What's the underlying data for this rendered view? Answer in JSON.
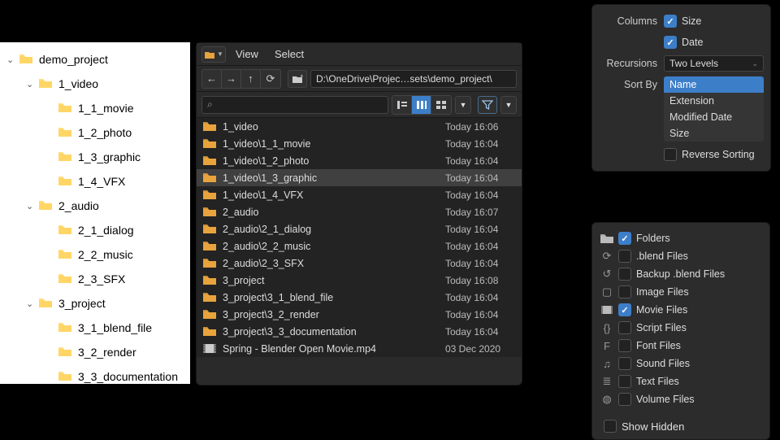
{
  "tree": {
    "root": "demo_project",
    "nodes": [
      {
        "depth": 0,
        "expand": true,
        "name": "demo_project"
      },
      {
        "depth": 1,
        "expand": true,
        "name": "1_video"
      },
      {
        "depth": 2,
        "expand": null,
        "name": "1_1_movie"
      },
      {
        "depth": 2,
        "expand": null,
        "name": "1_2_photo"
      },
      {
        "depth": 2,
        "expand": null,
        "name": "1_3_graphic"
      },
      {
        "depth": 2,
        "expand": null,
        "name": "1_4_VFX"
      },
      {
        "depth": 1,
        "expand": true,
        "name": "2_audio"
      },
      {
        "depth": 2,
        "expand": null,
        "name": "2_1_dialog"
      },
      {
        "depth": 2,
        "expand": null,
        "name": "2_2_music"
      },
      {
        "depth": 2,
        "expand": null,
        "name": "2_3_SFX"
      },
      {
        "depth": 1,
        "expand": true,
        "name": "3_project"
      },
      {
        "depth": 2,
        "expand": null,
        "name": "3_1_blend_file"
      },
      {
        "depth": 2,
        "expand": null,
        "name": "3_2_render"
      },
      {
        "depth": 2,
        "expand": null,
        "name": "3_3_documentation"
      }
    ]
  },
  "fbrowser": {
    "menu_view": "View",
    "menu_select": "Select",
    "path": "D:\\OneDrive\\Projec…sets\\demo_project\\",
    "items": [
      {
        "icon": "folder",
        "name": "1_video",
        "date": "Today 16:06"
      },
      {
        "icon": "folder",
        "name": "1_video\\1_1_movie",
        "date": "Today 16:04"
      },
      {
        "icon": "folder",
        "name": "1_video\\1_2_photo",
        "date": "Today 16:04"
      },
      {
        "icon": "folder",
        "name": "1_video\\1_3_graphic",
        "date": "Today 16:04",
        "sel": true
      },
      {
        "icon": "folder",
        "name": "1_video\\1_4_VFX",
        "date": "Today 16:04"
      },
      {
        "icon": "folder",
        "name": "2_audio",
        "date": "Today 16:07"
      },
      {
        "icon": "folder",
        "name": "2_audio\\2_1_dialog",
        "date": "Today 16:04"
      },
      {
        "icon": "folder",
        "name": "2_audio\\2_2_music",
        "date": "Today 16:04"
      },
      {
        "icon": "folder",
        "name": "2_audio\\2_3_SFX",
        "date": "Today 16:04"
      },
      {
        "icon": "folder",
        "name": "3_project",
        "date": "Today 16:08"
      },
      {
        "icon": "folder",
        "name": "3_project\\3_1_blend_file",
        "date": "Today 16:04"
      },
      {
        "icon": "folder",
        "name": "3_project\\3_2_render",
        "date": "Today 16:04"
      },
      {
        "icon": "folder",
        "name": "3_project\\3_3_documentation",
        "date": "Today 16:04"
      },
      {
        "icon": "movie",
        "name": "Spring - Blender Open Movie.mp4",
        "date": "03 Dec 2020"
      }
    ]
  },
  "opts": {
    "labels": {
      "columns": "Columns",
      "recursions": "Recursions",
      "sortby": "Sort By",
      "reverse": "Reverse Sorting"
    },
    "columns": {
      "size_label": "Size",
      "size_checked": true,
      "date_label": "Date",
      "date_checked": true
    },
    "recursions_value": "Two Levels",
    "sort_options": [
      "Name",
      "Extension",
      "Modified Date",
      "Size"
    ],
    "sort_active": "Name",
    "reverse_checked": false
  },
  "filters": {
    "items": [
      {
        "icon": "folder-icon",
        "label": "Folders",
        "checked": true
      },
      {
        "icon": "blender-icon",
        "label": ".blend Files",
        "checked": false
      },
      {
        "icon": "backup-icon",
        "label": "Backup .blend Files",
        "checked": false
      },
      {
        "icon": "image-icon",
        "label": "Image Files",
        "checked": false
      },
      {
        "icon": "movie-icon",
        "label": "Movie Files",
        "checked": true
      },
      {
        "icon": "script-icon",
        "label": "Script Files",
        "checked": false
      },
      {
        "icon": "font-icon",
        "label": "Font Files",
        "checked": false
      },
      {
        "icon": "sound-icon",
        "label": "Sound Files",
        "checked": false
      },
      {
        "icon": "text-icon",
        "label": "Text Files",
        "checked": false
      },
      {
        "icon": "volume-icon",
        "label": "Volume Files",
        "checked": false
      }
    ],
    "show_hidden_label": "Show Hidden",
    "show_hidden_checked": false
  }
}
